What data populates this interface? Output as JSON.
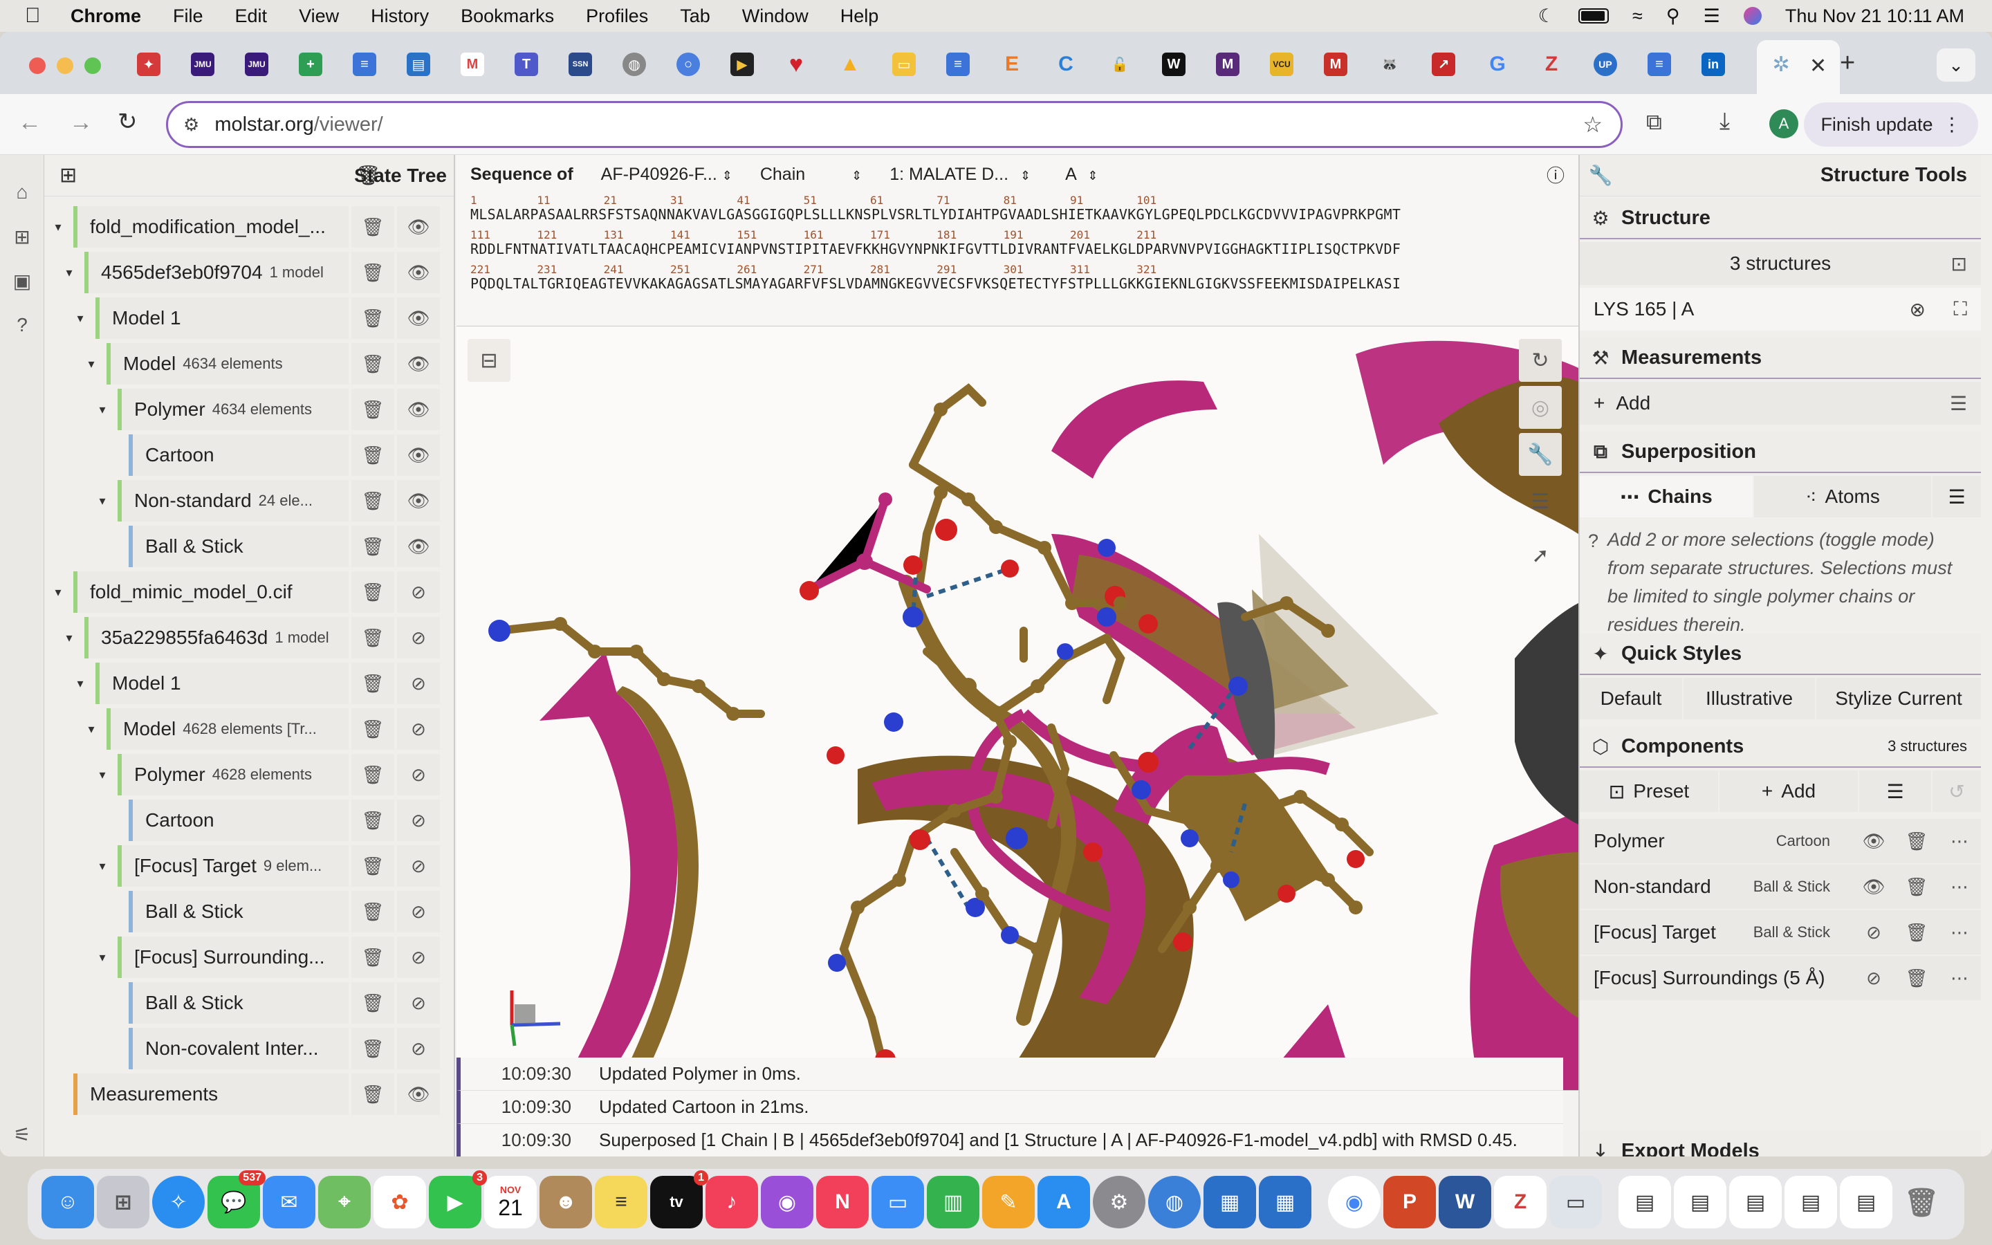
{
  "menubar": {
    "app": "Chrome",
    "items": [
      "File",
      "Edit",
      "View",
      "History",
      "Bookmarks",
      "Profiles",
      "Tab",
      "Window",
      "Help"
    ],
    "datetime": "Thu Nov 21  10:11 AM"
  },
  "browser": {
    "url_domain": "molstar.org",
    "url_path": "/viewer/",
    "finish_update": "Finish update",
    "profile_initial": "A"
  },
  "state_tree": {
    "title": "State Tree",
    "rows": [
      {
        "label": "fold_modification_model_...",
        "sub": "",
        "visible": true
      },
      {
        "label": "4565def3eb0f9704",
        "sub": "1 model",
        "visible": true
      },
      {
        "label": "Model 1",
        "sub": "",
        "visible": true
      },
      {
        "label": "Model",
        "sub": "4634 elements",
        "visible": true
      },
      {
        "label": "Polymer",
        "sub": "4634 elements",
        "visible": true
      },
      {
        "label": "Cartoon",
        "sub": "",
        "visible": true
      },
      {
        "label": "Non-standard",
        "sub": "24 ele...",
        "visible": true
      },
      {
        "label": "Ball & Stick",
        "sub": "",
        "visible": true
      },
      {
        "label": "fold_mimic_model_0.cif",
        "sub": "",
        "visible": false
      },
      {
        "label": "35a229855fa6463d",
        "sub": "1 model",
        "visible": false
      },
      {
        "label": "Model 1",
        "sub": "",
        "visible": false
      },
      {
        "label": "Model",
        "sub": "4628 elements [Tr...",
        "visible": false
      },
      {
        "label": "Polymer",
        "sub": "4628 elements",
        "visible": false
      },
      {
        "label": "Cartoon",
        "sub": "",
        "visible": false
      },
      {
        "label": "[Focus] Target",
        "sub": "9 elem...",
        "visible": false
      },
      {
        "label": "Ball & Stick",
        "sub": "",
        "visible": false
      },
      {
        "label": "[Focus] Surrounding...",
        "sub": "",
        "visible": false
      },
      {
        "label": "Ball & Stick",
        "sub": "",
        "visible": false
      },
      {
        "label": "Non-covalent Inter...",
        "sub": "",
        "visible": false
      },
      {
        "label": "Measurements",
        "sub": "",
        "visible": true
      }
    ]
  },
  "sequence": {
    "label": "Sequence of",
    "structure": "AF-P40926-F...",
    "mode": "Chain",
    "entity": "1: MALATE D...",
    "chain": "A",
    "nums1": "1         11        21        31        41        51        61        71        81        91        101",
    "line1": "MLSALARPASAALRRSFSTSAQNNAKVAVLGASGGIGQPLSLLLKNSPLVSRLTLYDIAHTPGVAADLSHIETKAAVKGYLGPEQLPDCLKGCDVVVIPAGVPRKPGMT",
    "nums2": "111       121       131       141       151       161       171       181       191       201       211",
    "line2": "RDDLFNTNATIVATLTAACAQHCPEAMICVIANPVNSTIPITAEVFKKHGVYNPNKIFGVTTLDIVRANTFVAELKGLDPARVNVPVIGGHAGKTIIPLISQCTPKVDF",
    "nums3": "221       231       241       251       261       271       281       291       301       311       321",
    "line3": "PQDQLTALTGRIQEAGTEVVKAKAGAGSATLSMAYAGARFVFSLVDAMNGKEGVVECSFVKSQETECTYFSTPLLLGKKGIEKNLGIGKVSSFEEKMISDAIPELKASI"
  },
  "log": [
    {
      "time": "10:09:30",
      "msg": "Updated Polymer in 0ms."
    },
    {
      "time": "10:09:30",
      "msg": "Updated Cartoon in 21ms."
    },
    {
      "time": "10:09:30",
      "msg": "Superposed [1 Chain | B | 4565def3eb0f9704] and [1 Structure | A | AF-P40926-F1-model_v4.pdb] with RMSD 0.45."
    }
  ],
  "tools": {
    "title": "Structure Tools",
    "structure": {
      "title": "Structure",
      "count": "3 structures",
      "selection": "LYS 165 | A"
    },
    "measurements": {
      "title": "Measurements",
      "add": "Add"
    },
    "superposition": {
      "title": "Superposition",
      "tab_chains": "Chains",
      "tab_atoms": "Atoms",
      "hint": "Add 2 or more selections (toggle mode) from separate structures. Selections must be limited to single polymer chains or residues therein."
    },
    "quick_styles": {
      "title": "Quick Styles",
      "default": "Default",
      "illustrative": "Illustrative",
      "stylize": "Stylize Current"
    },
    "components": {
      "title": "Components",
      "count": "3 structures",
      "preset": "Preset",
      "add": "Add",
      "items": [
        {
          "name": "Polymer",
          "style": "Cartoon",
          "visible": true
        },
        {
          "name": "Non-standard",
          "style": "Ball & Stick",
          "visible": true
        },
        {
          "name": "[Focus] Target",
          "style": "Ball & Stick",
          "visible": false
        },
        {
          "name": "[Focus] Surroundings (5 Å)",
          "style": "",
          "visible": false
        }
      ]
    },
    "export": {
      "title": "Export Models"
    }
  },
  "dock": {
    "messages_badge": "537",
    "facetime_badge": "3",
    "tv_badge": "1",
    "calendar_month": "NOV",
    "calendar_day": "21"
  },
  "colors": {
    "accent": "#8b5fbf",
    "cartoon_magenta": "#b8297a",
    "cartoon_brown": "#8a6a2a",
    "oxygen": "#d42020",
    "nitrogen": "#2a3fd0"
  }
}
